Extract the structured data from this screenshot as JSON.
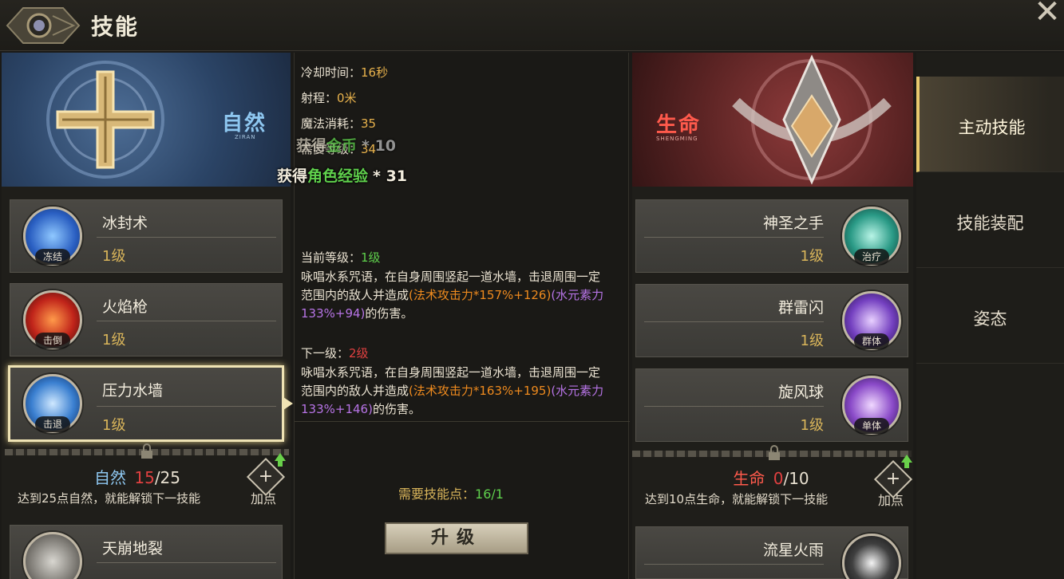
{
  "header": {
    "title": "技能",
    "close_symbol": "✕"
  },
  "left": {
    "banner": {
      "label": "自然",
      "sub": "ZIRAN"
    },
    "skills": [
      {
        "name": "冰封术",
        "level": "1级",
        "tag": "冻结"
      },
      {
        "name": "火焰枪",
        "level": "1级",
        "tag": "击倒"
      },
      {
        "name": "压力水墙",
        "level": "1级",
        "tag": "击退"
      }
    ],
    "points": {
      "label": "自然",
      "current": "15",
      "total": "/25"
    },
    "hint": "达到25点自然，就能解锁下一技能",
    "add_label": "加点",
    "locked_skill": {
      "name": "天崩地裂"
    }
  },
  "detail": {
    "cooldown_label": "冷却时间：",
    "cooldown_value": "16秒",
    "range_label": "射程：",
    "range_value": "0米",
    "mana_label": "魔法消耗：",
    "mana_value": "35",
    "req_label": "需要等级：",
    "req_value": "34",
    "float_gold_prefix": "获得",
    "float_gold_item": "金币",
    "float_gold_value": "* 10",
    "float_exp_prefix": "获得",
    "float_exp_item": "角色经验",
    "float_exp_value": "* 31",
    "current_label": "当前等级：",
    "current_value": "1级",
    "current_desc_1": "咏唱水系咒语，在自身周围竖起一道水墙，击退周围一定范围内的敌人并造成",
    "current_desc_orange": "(法术攻击力*157%+126)",
    "current_desc_purple": "(水元素力133%+94)",
    "current_desc_end": "的伤害。",
    "next_label": "下一级：",
    "next_value": "2级",
    "next_desc_1": "咏唱水系咒语，在自身周围竖起一道水墙，击退周围一定范围内的敌人并造成",
    "next_desc_orange": "(法术攻击力*163%+195)",
    "next_desc_purple": "(水元素力133%+146)",
    "next_desc_end": "的伤害。",
    "need_points_label": "需要技能点：",
    "need_points_value": "16/1",
    "upgrade_label": "升级"
  },
  "right": {
    "banner": {
      "label": "生命",
      "sub": "SHENGMING"
    },
    "skills": [
      {
        "name": "神圣之手",
        "level": "1级",
        "tag": "治疗"
      },
      {
        "name": "群雷闪",
        "level": "1级",
        "tag": "群体"
      },
      {
        "name": "旋风球",
        "level": "1级",
        "tag": "单体"
      }
    ],
    "points": {
      "label": "生命",
      "current": "0",
      "total": "/10"
    },
    "hint": "达到10点生命，就能解锁下一技能",
    "add_label": "加点",
    "locked_skill": {
      "name": "流星火雨"
    }
  },
  "tabs": [
    "主动技能",
    "技能装配",
    "姿态"
  ],
  "colors": {
    "gold": "#e8b24c",
    "green": "#5fd04c",
    "red": "#e04040",
    "orange": "#ee8a1e",
    "purple": "#b774e6"
  }
}
